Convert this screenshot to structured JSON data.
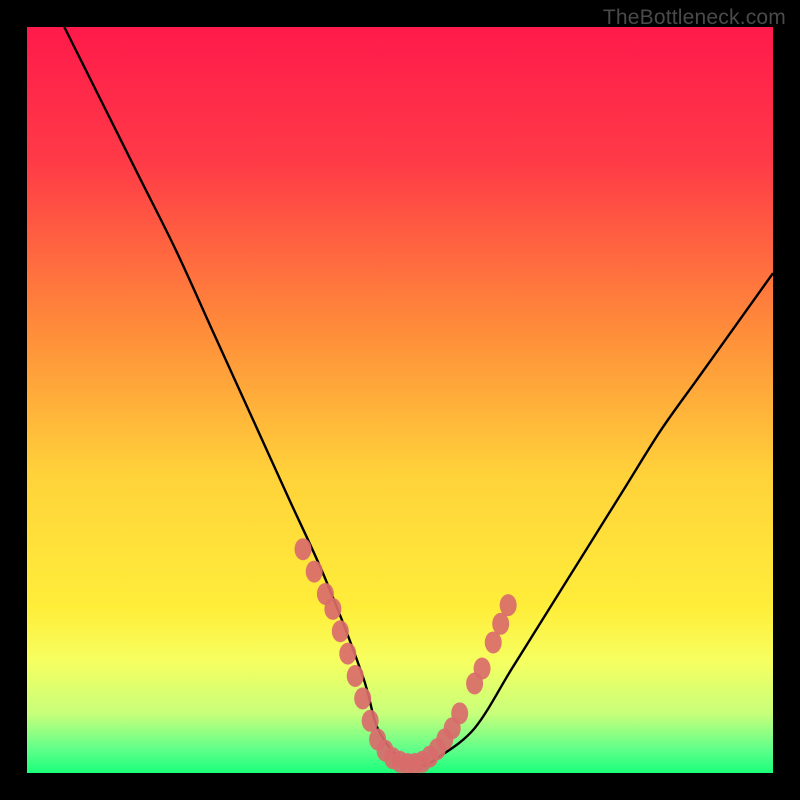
{
  "watermark": "TheBottleneck.com",
  "chart_data": {
    "type": "line",
    "title": "",
    "xlabel": "",
    "ylabel": "",
    "xlim": [
      0,
      100
    ],
    "ylim": [
      0,
      100
    ],
    "gradient_stops": [
      {
        "offset": 0,
        "color": "#ff1a4b"
      },
      {
        "offset": 18,
        "color": "#ff3a47"
      },
      {
        "offset": 40,
        "color": "#ff8a3a"
      },
      {
        "offset": 60,
        "color": "#ffd23a"
      },
      {
        "offset": 78,
        "color": "#ffee3a"
      },
      {
        "offset": 85,
        "color": "#f6ff60"
      },
      {
        "offset": 92,
        "color": "#c8ff7a"
      },
      {
        "offset": 97,
        "color": "#5cff8a"
      },
      {
        "offset": 100,
        "color": "#1aff7a"
      }
    ],
    "series": [
      {
        "name": "bottleneck-curve",
        "x": [
          5,
          10,
          15,
          20,
          25,
          30,
          35,
          40,
          45,
          47,
          50,
          53,
          55,
          60,
          65,
          70,
          75,
          80,
          85,
          90,
          95,
          100
        ],
        "y": [
          100,
          90,
          80,
          70,
          59,
          48,
          37,
          26,
          13,
          6,
          2,
          1,
          2,
          6,
          14,
          22,
          30,
          38,
          46,
          53,
          60,
          67
        ]
      }
    ],
    "markers": {
      "name": "highlight-dots",
      "color": "#d96b6b",
      "points": [
        {
          "x": 37,
          "y": 30
        },
        {
          "x": 38.5,
          "y": 27
        },
        {
          "x": 40,
          "y": 24
        },
        {
          "x": 41,
          "y": 22
        },
        {
          "x": 42,
          "y": 19
        },
        {
          "x": 43,
          "y": 16
        },
        {
          "x": 44,
          "y": 13
        },
        {
          "x": 45,
          "y": 10
        },
        {
          "x": 46,
          "y": 7
        },
        {
          "x": 47,
          "y": 4.5
        },
        {
          "x": 48,
          "y": 3
        },
        {
          "x": 49,
          "y": 2
        },
        {
          "x": 50,
          "y": 1.5
        },
        {
          "x": 51,
          "y": 1.2
        },
        {
          "x": 52,
          "y": 1.2
        },
        {
          "x": 53,
          "y": 1.5
        },
        {
          "x": 54,
          "y": 2.2
        },
        {
          "x": 55,
          "y": 3.2
        },
        {
          "x": 56,
          "y": 4.5
        },
        {
          "x": 57,
          "y": 6
        },
        {
          "x": 58,
          "y": 8
        },
        {
          "x": 60,
          "y": 12
        },
        {
          "x": 61,
          "y": 14
        },
        {
          "x": 62.5,
          "y": 17.5
        },
        {
          "x": 63.5,
          "y": 20
        },
        {
          "x": 64.5,
          "y": 22.5
        }
      ]
    }
  }
}
